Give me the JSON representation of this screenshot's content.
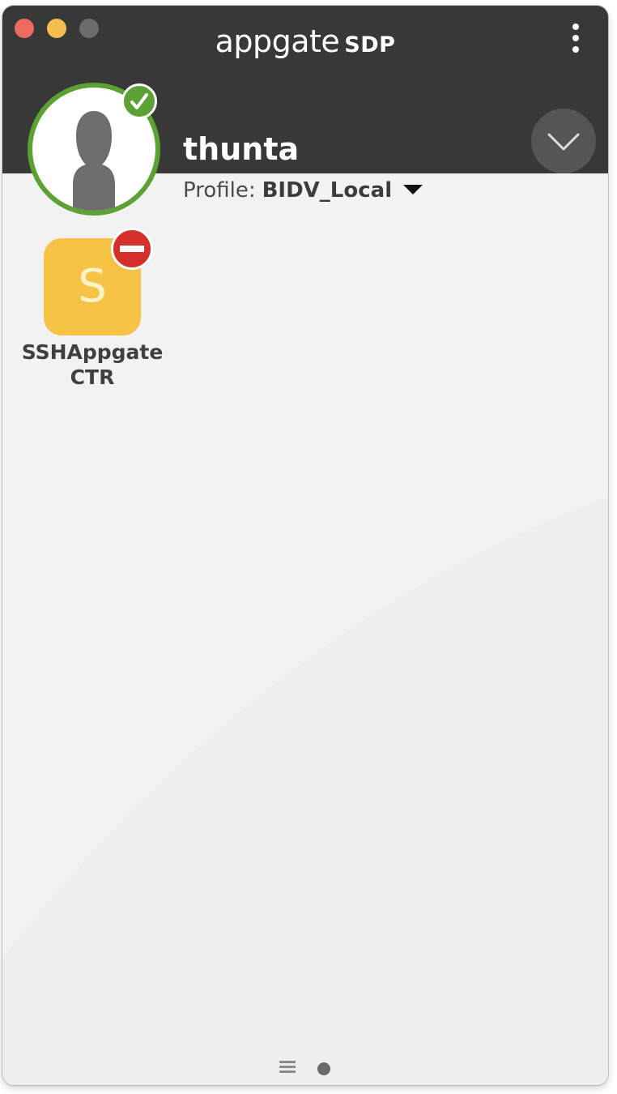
{
  "window": {
    "brand": {
      "name": "appgate",
      "product": "SDP"
    }
  },
  "user": {
    "name": "thunta",
    "status": "connected"
  },
  "profile": {
    "label": "Profile:",
    "value": "BIDV_Local"
  },
  "entitlements": [
    {
      "letter": "S",
      "name_line1": "SSHAppgate",
      "name_line2": "CTR",
      "status": "blocked"
    }
  ],
  "colors": {
    "titlebar": "#383838",
    "body": "#efefef",
    "status_green": "#5ba133",
    "blocked_red": "#d6302d",
    "tile_yellow": "#f6c347"
  },
  "icons": {
    "menu": "more-vertical-icon",
    "collapse": "chevron-down-icon",
    "status": "checkmark-icon",
    "blocked": "no-entry-icon",
    "list_view": "list-icon",
    "page_indicator": "dot-icon"
  }
}
